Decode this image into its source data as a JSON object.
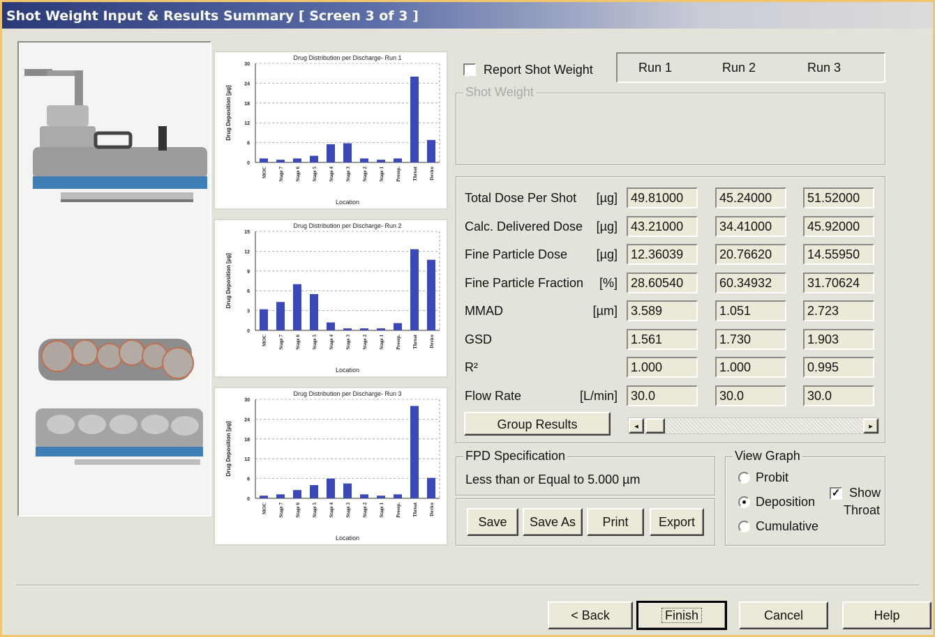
{
  "window": {
    "title": "Shot Weight Input & Results Summary [ Screen 3 of 3 ]"
  },
  "charts_common": {
    "ylabel": "Drug Deposition [µg]",
    "xlabel": "Location",
    "categories": [
      "MOC",
      "Stage 7",
      "Stage 6",
      "Stage 5",
      "Stage 4",
      "Stage 3",
      "Stage 2",
      "Stage 1",
      "Presep.",
      "Throat",
      "Device"
    ]
  },
  "chart_data": [
    {
      "type": "bar",
      "title": "Drug Distribution per Discharge- Run 1",
      "xlabel": "Location",
      "ylabel": "Drug Deposition [µg]",
      "categories": [
        "MOC",
        "Stage 7",
        "Stage 6",
        "Stage 5",
        "Stage 4",
        "Stage 3",
        "Stage 2",
        "Stage 1",
        "Presep.",
        "Throat",
        "Device"
      ],
      "values": [
        1.2,
        0.8,
        1.2,
        2.0,
        5.5,
        5.8,
        1.2,
        0.8,
        1.2,
        26.0,
        6.8
      ],
      "ylim": [
        0,
        30
      ],
      "yticks": [
        0,
        6,
        12,
        18,
        24,
        30
      ],
      "grid": true
    },
    {
      "type": "bar",
      "title": "Drug Distribution per Discharge- Run 2",
      "xlabel": "Location",
      "ylabel": "Drug Deposition [µg]",
      "categories": [
        "MOC",
        "Stage 7",
        "Stage 6",
        "Stage 5",
        "Stage 4",
        "Stage 3",
        "Stage 2",
        "Stage 1",
        "Presep.",
        "Throat",
        "Device"
      ],
      "values": [
        3.2,
        4.3,
        7.0,
        5.5,
        1.2,
        0.3,
        0.3,
        0.3,
        1.1,
        12.3,
        10.7
      ],
      "ylim": [
        0,
        15
      ],
      "yticks": [
        0,
        3,
        6,
        9,
        12,
        15
      ],
      "grid": true
    },
    {
      "type": "bar",
      "title": "Drug Distribution per Discharge- Run 3",
      "xlabel": "Location",
      "ylabel": "Drug Deposition [µg]",
      "categories": [
        "MOC",
        "Stage 7",
        "Stage 6",
        "Stage 5",
        "Stage 4",
        "Stage 3",
        "Stage 2",
        "Stage 1",
        "Presep.",
        "Throat",
        "Device"
      ],
      "values": [
        0.8,
        1.2,
        2.5,
        4.0,
        6.0,
        4.5,
        1.2,
        0.8,
        1.2,
        28.0,
        6.2
      ],
      "ylim": [
        0,
        30
      ],
      "yticks": [
        0,
        6,
        12,
        18,
        24,
        30
      ],
      "grid": true
    }
  ],
  "report": {
    "checkbox_label": "Report Shot Weight",
    "checked": false
  },
  "runs": [
    "Run 1",
    "Run 2",
    "Run 3"
  ],
  "shot_weight": {
    "label": "Shot Weight"
  },
  "results": [
    {
      "label": "Total Dose Per Shot",
      "unit": "[µg]",
      "values": [
        "49.81000",
        "45.24000",
        "51.52000"
      ]
    },
    {
      "label": "Calc. Delivered Dose",
      "unit": "[µg]",
      "values": [
        "43.21000",
        "34.41000",
        "45.92000"
      ]
    },
    {
      "label": "Fine Particle Dose",
      "unit": "[µg]",
      "values": [
        "12.36039",
        "20.76620",
        "14.55950"
      ]
    },
    {
      "label": "Fine Particle Fraction",
      "unit": "[%]",
      "values": [
        "28.60540",
        "60.34932",
        "31.70624"
      ]
    },
    {
      "label": "MMAD",
      "unit": "[µm]",
      "values": [
        "3.589",
        "1.051",
        "2.723"
      ]
    },
    {
      "label": "GSD",
      "unit": "",
      "values": [
        "1.561",
        "1.730",
        "1.903"
      ]
    },
    {
      "label": "R²",
      "unit": "",
      "values": [
        "1.000",
        "1.000",
        "0.995"
      ]
    },
    {
      "label": "Flow Rate",
      "unit": "[L/min]",
      "values": [
        "30.0",
        "30.0",
        "30.0"
      ]
    }
  ],
  "group_results_label": "Group Results",
  "fpd": {
    "label": "FPD Specification",
    "text": "Less than or Equal to 5.000 µm"
  },
  "file_buttons": {
    "save": "Save",
    "save_as": "Save As",
    "print": "Print",
    "export": "Export"
  },
  "view_graph": {
    "label": "View Graph",
    "options": [
      "Probit",
      "Deposition",
      "Cumulative"
    ],
    "selected": "Deposition",
    "show_throat_line1": "Show",
    "show_throat_line2": "Throat",
    "show_throat_checked": true
  },
  "nav": {
    "back": "< Back",
    "finish": "Finish",
    "cancel": "Cancel",
    "help": "Help"
  },
  "colors": {
    "bar": "#3a48b8",
    "titlebar": "#2a3a78",
    "window_border": "#f1c46e"
  }
}
